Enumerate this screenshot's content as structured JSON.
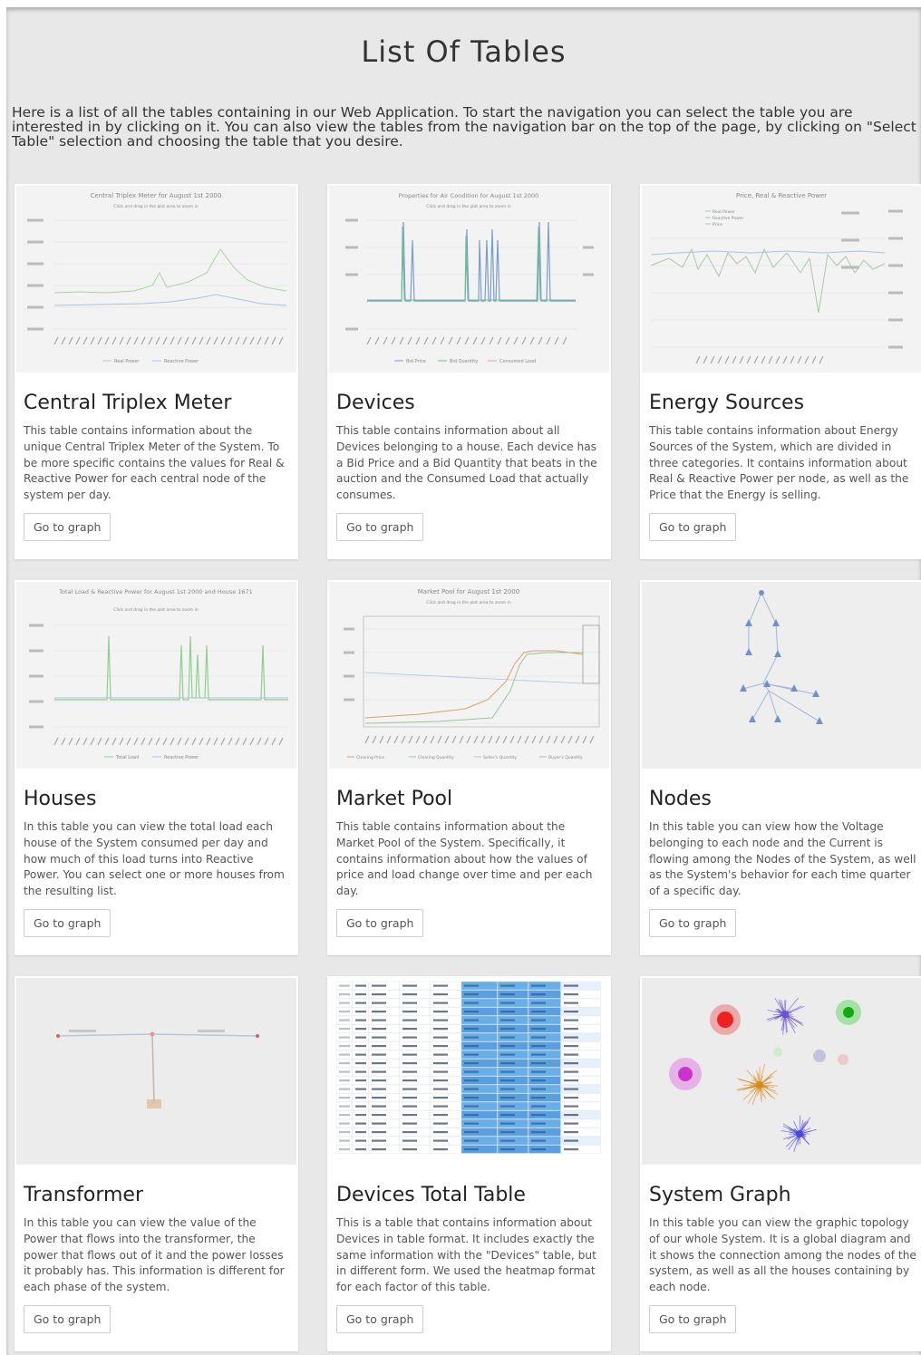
{
  "page": {
    "title": "List Of Tables",
    "intro": "Here is a list of all the tables containing in our Web Application. To start the navigation you can select the table you are interested in by clicking on it. You can also view the tables from the navigation bar on the top of the page, by clicking on \"Select Table\" selection and choosing the table that you desire."
  },
  "cards": [
    {
      "title": "Central Triplex Meter",
      "description": "This table contains information about the unique Central Triplex Meter of the System. To be more specific contains the values for Real & Reactive Power for each central node of the system per day.",
      "button": "Go to graph",
      "thumb_title": "Central Triplex Meter for August 1st 2000",
      "thumb_subtitle": "Click and drag in the plot area to zoom in",
      "thumb_legend": [
        "Real Power",
        "Reactive Power"
      ]
    },
    {
      "title": "Devices",
      "description": "This table contains information about all Devices belonging to a house. Each device has a Bid Price and a Bid Quantity that beats in the auction and the Consumed Load that actually consumes.",
      "button": "Go to graph",
      "thumb_title": "Properties for Air Condition for August 1st 2000",
      "thumb_subtitle": "Click and drag in the plot area to zoom in",
      "thumb_legend": [
        "Bid Price",
        "Bid Quantity",
        "Consumed Load"
      ]
    },
    {
      "title": "Energy Sources",
      "description": "This table contains information about Energy Sources of the System, which are divided in three categories. It contains information about Real & Reactive Power per node, as well as the Price that the Energy is selling.",
      "button": "Go to graph",
      "thumb_title": "Price, Real & Reactive Power",
      "thumb_subtitle": "",
      "thumb_legend": [
        "Real Power",
        "Reactive Power",
        "Price"
      ]
    },
    {
      "title": "Houses",
      "description": "In this table you can view the total load each house of the System consumed per day and how much of this load turns into Reactive Power. You can select one or more houses from the resulting list.",
      "button": "Go to graph",
      "thumb_title": "Total Load & Reactive Power for August 1st 2000 and House 1671",
      "thumb_subtitle": "Click and drag in the plot area to zoom in",
      "thumb_legend": [
        "Total Load",
        "Reactive Power"
      ]
    },
    {
      "title": "Market Pool",
      "description": "This table contains information about the Market Pool of the System. Specifically, it contains information about how the values of price and load change over time and per each day.",
      "button": "Go to graph",
      "thumb_title": "Market Pool for August 1st 2000",
      "thumb_subtitle": "Click and drag in the plot area to zoom in",
      "thumb_legend": [
        "Clearing Price",
        "Clearing Quantity",
        "Seller's Quantity",
        "Buyer's Quantity"
      ]
    },
    {
      "title": "Nodes",
      "description": "In this table you can view how the Voltage belonging to each node and the Current is flowing among the Nodes of the System, as well as the System's behavior for each time quarter of a specific day.",
      "button": "Go to graph",
      "thumb_title": "",
      "thumb_subtitle": "",
      "thumb_legend": []
    },
    {
      "title": "Transformer",
      "description": "In this table you can view the value of the Power that flows into the transformer, the power that flows out of it and the power losses it probably has. This information is different for each phase of the system.",
      "button": "Go to graph",
      "thumb_title": "",
      "thumb_subtitle": "",
      "thumb_legend": []
    },
    {
      "title": "Devices Total Table",
      "description": "This is a table that contains information about Devices in table format. It includes exactly the same information with the \"Devices\" table, but in different form. We used the heatmap format for each factor of this table.",
      "button": "Go to graph",
      "thumb_title": "",
      "thumb_subtitle": "",
      "thumb_legend": []
    },
    {
      "title": "System Graph",
      "description": "In this table you can view the graphic topology of our whole System. It is a global diagram and it shows the connection among the nodes of the system, as well as all the houses containing by each node.",
      "button": "Go to graph",
      "thumb_title": "",
      "thumb_subtitle": "",
      "thumb_legend": []
    }
  ]
}
